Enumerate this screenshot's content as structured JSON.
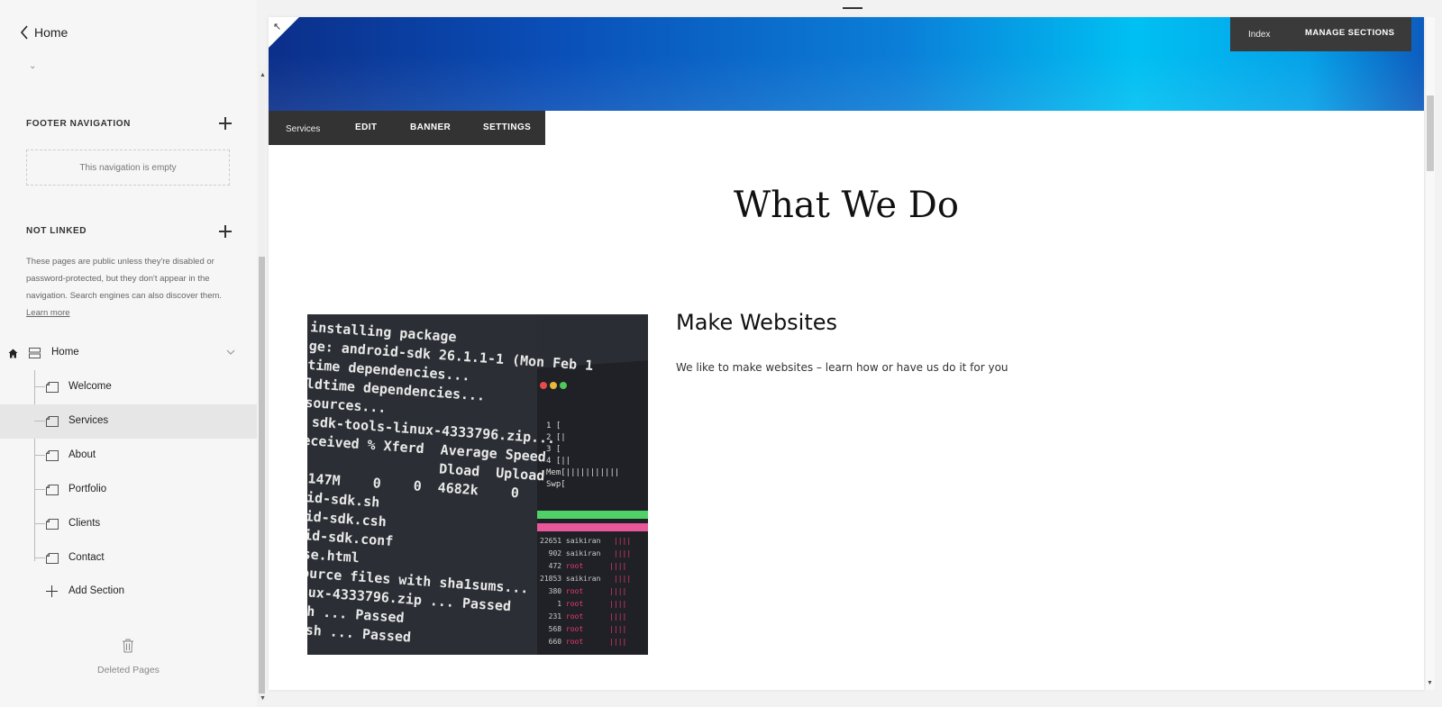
{
  "sidebar": {
    "back_label": "Home",
    "footer_nav": {
      "heading": "FOOTER NAVIGATION",
      "empty_text": "This navigation is empty"
    },
    "not_linked": {
      "heading": "NOT LINKED",
      "description": "These pages are public unless they're disabled or password-protected, but they don't appear in the navigation. Search engines can also discover them.",
      "learn_more": "Learn more"
    },
    "index_page": {
      "label": "Home"
    },
    "sections": [
      {
        "label": "Welcome",
        "active": false
      },
      {
        "label": "Services",
        "active": true
      },
      {
        "label": "About",
        "active": false
      },
      {
        "label": "Portfolio",
        "active": false
      },
      {
        "label": "Clients",
        "active": false
      },
      {
        "label": "Contact",
        "active": false
      }
    ],
    "add_section": "Add Section",
    "deleted_pages": "Deleted Pages"
  },
  "preview": {
    "index_bar": {
      "label": "Index",
      "manage_button": "MANAGE SECTIONS"
    },
    "section_bar": {
      "name": "Services",
      "edit": "EDIT",
      "banner": "BANNER",
      "settings": "SETTINGS"
    },
    "heading": "What We Do",
    "card": {
      "title": "Make Websites",
      "body": "We like to make websites – learn how or have us do it for you"
    },
    "colors": {
      "banner_start": "#0b2f8a",
      "banner_mid": "#00c0f2",
      "toolbar_bg": "#333333"
    }
  }
}
